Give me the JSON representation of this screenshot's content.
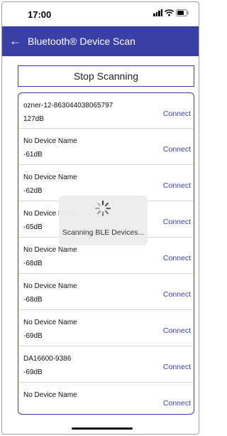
{
  "status_bar": {
    "time": "17:00"
  },
  "app_bar": {
    "back_glyph": "←",
    "title": "Bluetooth® Device Scan"
  },
  "stop_button": {
    "label": "Stop Scanning"
  },
  "devices": [
    {
      "name": "ozner-12-863044038065797",
      "rssi": "127dB",
      "action": "Connect"
    },
    {
      "name": "No Device Name",
      "rssi": "-61dB",
      "action": "Connect"
    },
    {
      "name": "No Device Name",
      "rssi": "-62dB",
      "action": "Connect"
    },
    {
      "name": "No Device Name",
      "rssi": "-65dB",
      "action": "Connect"
    },
    {
      "name": "No Device Name",
      "rssi": "-68dB",
      "action": "Connect"
    },
    {
      "name": "No Device Name",
      "rssi": "-68dB",
      "action": "Connect"
    },
    {
      "name": "No Device Name",
      "rssi": "-69dB",
      "action": "Connect"
    },
    {
      "name": "DA16600-9386",
      "rssi": "-69dB",
      "action": "Connect"
    },
    {
      "name": "No Device Name",
      "rssi": "",
      "action": "Connect"
    }
  ],
  "loading_overlay": {
    "text": "Scanning BLE Devices..."
  },
  "colors": {
    "accent": "#3a3fa6",
    "divider": "#d6d6d6"
  },
  "icons": [
    "back-arrow-icon",
    "signal-icon",
    "wifi-icon",
    "battery-icon",
    "spinner-icon"
  ]
}
